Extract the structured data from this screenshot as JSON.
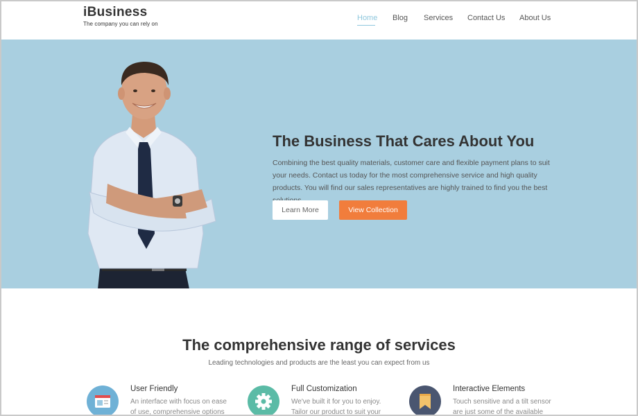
{
  "brand": {
    "name": "iBusiness",
    "tagline": "The company you can rely on"
  },
  "nav": {
    "items": [
      {
        "label": "Home",
        "active": true
      },
      {
        "label": "Blog",
        "active": false
      },
      {
        "label": "Services",
        "active": false
      },
      {
        "label": "Contact Us",
        "active": false
      },
      {
        "label": "About Us",
        "active": false
      }
    ]
  },
  "hero": {
    "title": "The Business That Cares About You",
    "text": "Combining the best quality materials, customer care and flexible payment plans to suit your needs. Contact us today for the most comprehensive service and high quality products. You will find our sales representatives are highly trained to find you the best solutions.",
    "learn_more": "Learn More",
    "view_collection": "View Collection"
  },
  "services": {
    "title": "The comprehensive range of services",
    "subtitle": "Leading technologies and products are the least you can expect from us",
    "items": [
      {
        "title": "User Friendly",
        "text": "An interface with focus on ease of use, comprehensive options",
        "icon": "browser-window-icon",
        "color": "#6fb1d6"
      },
      {
        "title": "Full Customization",
        "text": "We've built it for you to enjoy. Tailor our product to suit your",
        "icon": "gear-icon",
        "color": "#5bbba6"
      },
      {
        "title": "Interactive Elements",
        "text": "Touch sensitive and a tilt sensor are just some of the available",
        "icon": "bookmark-icon",
        "color": "#4a5670"
      }
    ]
  },
  "colors": {
    "hero_bg": "#a9cfe0",
    "accent_orange": "#f17d3c",
    "nav_active": "#8fc7dd"
  }
}
